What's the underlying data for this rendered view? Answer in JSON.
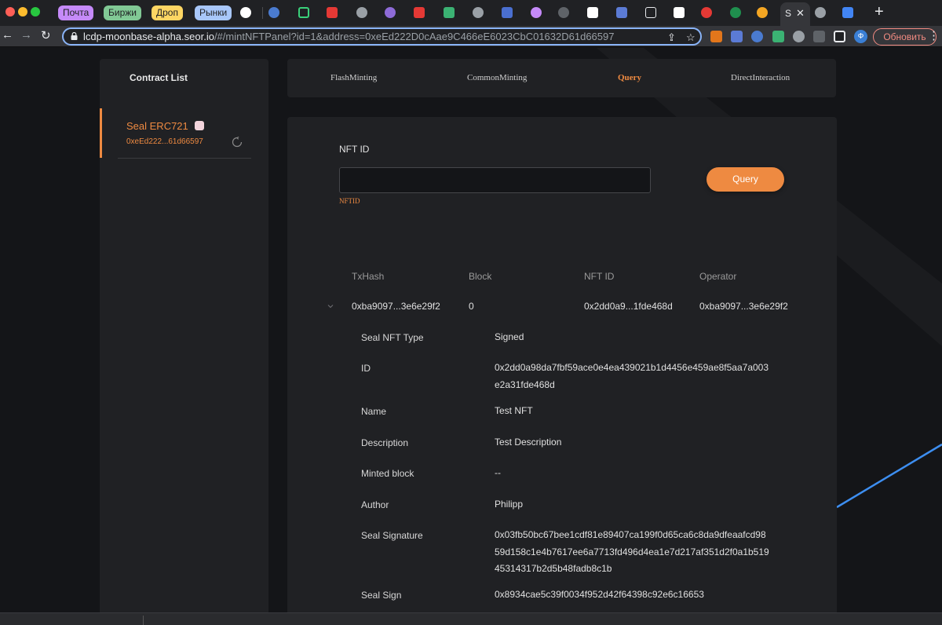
{
  "browser": {
    "tab_groups": [
      {
        "label": "Почта",
        "color": "#c58af9"
      },
      {
        "label": "Биржи",
        "color": "#81c995"
      },
      {
        "label": "Дроп",
        "color": "#fdd663"
      },
      {
        "label": "Рынки",
        "color": "#a8c7fa"
      }
    ],
    "active_tab_letter": "S",
    "url_host": "lcdp-moonbase-alpha.seor.io",
    "url_path": "/#/mintNFTPanel?id=1&address=0xeEd222D0cAae9C466eE6023CbC01632D61d66597",
    "profile_initial": "Ф",
    "update_label": "Обновить"
  },
  "sidebar": {
    "title": "Contract List",
    "contract": {
      "name": "Seal ERC721",
      "address": "0xeEd222...61d66597"
    }
  },
  "tabs": [
    "FlashMinting",
    "CommonMinting",
    "Query",
    "DirectInteraction"
  ],
  "active_tab": "Query",
  "query_form": {
    "label": "NFT ID",
    "value": "",
    "hint": "NFTID",
    "button": "Query"
  },
  "table": {
    "headers": [
      "TxHash",
      "Block",
      "NFT ID",
      "Operator"
    ],
    "row": [
      "0xba9097...3e6e29f2",
      "0",
      "0x2dd0a9...1fde468d",
      "0xba9097...3e6e29f2"
    ]
  },
  "details": [
    {
      "label": "Seal NFT Type",
      "value": "Signed"
    },
    {
      "label": "ID",
      "value": "0x2dd0a98da7fbf59ace0e4ea439021b1d4456e459ae8f5aa7a003e2a31fde468d"
    },
    {
      "label": "Name",
      "value": "Test NFT"
    },
    {
      "label": "Description",
      "value": "Test Description"
    },
    {
      "label": "Minted block",
      "value": "--"
    },
    {
      "label": "Author",
      "value": "Philipp"
    },
    {
      "label": "Seal Signature",
      "value": "0x03fb50bc67bee1cdf81e89407ca199f0d65ca6c8da9dfeaafcd9859d158c1e4b7617ee6a7713fd496d4ea1e7d217af351d2f0a1b51945314317b2d5b48fadb8c1b"
    },
    {
      "label": "Seal Sign",
      "value": "0x8934cae5c39f0034f952d42f64398c92e6c16653"
    }
  ],
  "colors": {
    "accent": "#ee8a41",
    "card": "#202124",
    "background": "#141518"
  }
}
